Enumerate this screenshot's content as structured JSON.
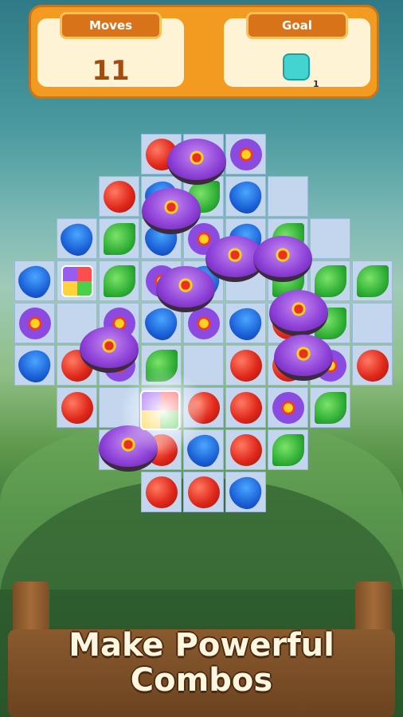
{
  "hud": {
    "moves_label": "Moves",
    "moves_value": "11",
    "goal_label": "Goal",
    "goal_icon": "cyan-tile-icon",
    "goal_count": "1"
  },
  "tagline": {
    "line1": "Make Powerful",
    "line2": "Combos"
  },
  "colors": {
    "hud_frame": "#f39a21",
    "hud_label": "#d8731a",
    "board_cell": "#c3d6ee",
    "goal_tile": "#43d3d0"
  },
  "board": {
    "piece_types": [
      "apple",
      "drop",
      "leaf",
      "flower",
      "rainbow-cube",
      "purple-blocker"
    ]
  }
}
